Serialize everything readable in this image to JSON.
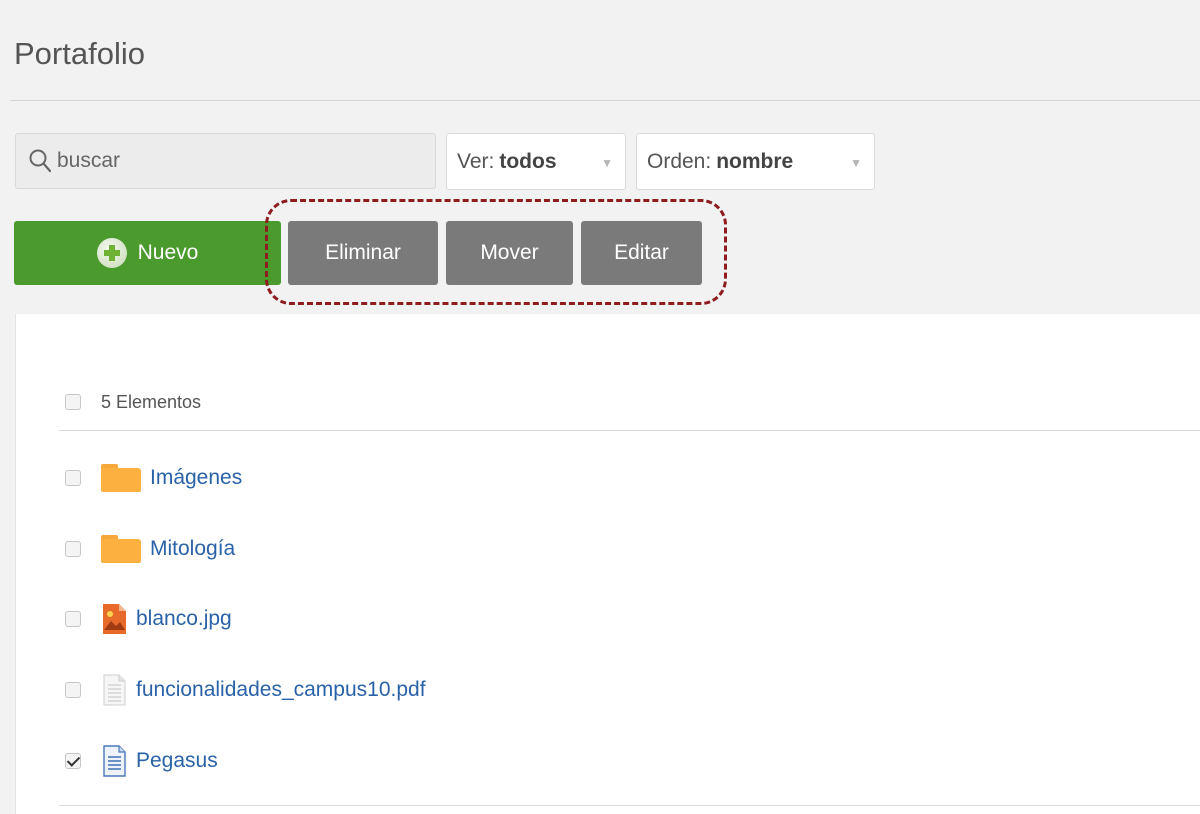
{
  "page": {
    "title": "Portafolio"
  },
  "toolbar": {
    "search_placeholder": "buscar",
    "view_label": "Ver:",
    "view_value": "todos",
    "order_label": "Orden:",
    "order_value": "nombre",
    "new_label": "Nuevo",
    "delete_label": "Eliminar",
    "move_label": "Mover",
    "edit_label": "Editar"
  },
  "list": {
    "count_label": "5 Elementos",
    "items": [
      {
        "name": "Imágenes",
        "type": "folder",
        "checked": false
      },
      {
        "name": "Mitología",
        "type": "folder",
        "checked": false
      },
      {
        "name": "blanco.jpg",
        "type": "image",
        "checked": false
      },
      {
        "name": "funcionalidades_campus10.pdf",
        "type": "file",
        "checked": false
      },
      {
        "name": "Pegasus",
        "type": "document",
        "checked": true
      }
    ]
  },
  "colors": {
    "new_button": "#4b9a2e",
    "action_buttons": "#7a7a7a",
    "link": "#2a62a8",
    "folder": "#fbb040",
    "highlight_dashed": "#8e1b1e"
  }
}
